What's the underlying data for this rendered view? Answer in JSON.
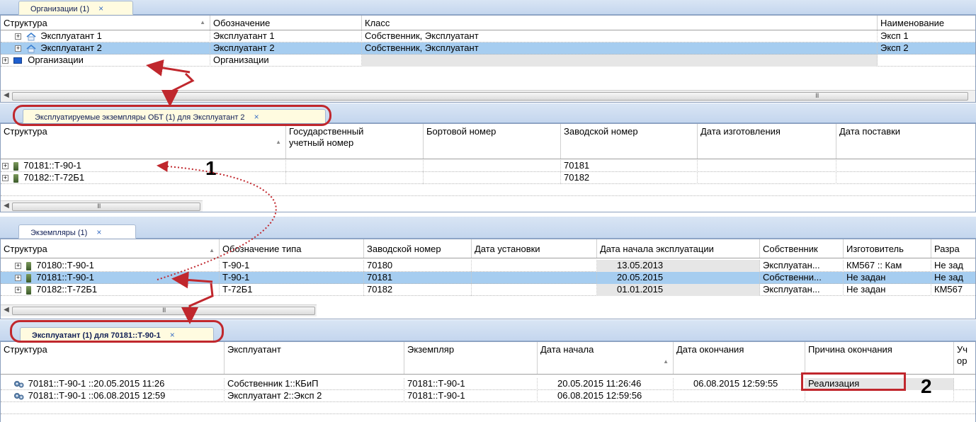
{
  "panel1": {
    "tab": "Организации (1)",
    "close": "×",
    "headers": [
      "Структура",
      "Обозначение",
      "Класс",
      "Наименование"
    ],
    "rows": [
      {
        "expander": "+",
        "name": "Эксплуатант 1",
        "designation": "Эксплуатант 1",
        "class": "Собственник, Эксплуатант",
        "title": "Эксп 1"
      },
      {
        "expander": "+",
        "name": "Эксплуатант 2",
        "designation": "Эксплуатант 2",
        "class": "Собственник, Эксплуатант",
        "title": "Эксп 2"
      },
      {
        "expander": "+",
        "name": "Организации",
        "designation": "Организации",
        "class": "",
        "title": ""
      }
    ],
    "scroll_grip": "III"
  },
  "panel2": {
    "tab": "Эксплуатируемые экземпляры ОБТ (1) для Эксплуатант 2",
    "close": "×",
    "headers": [
      "Структура",
      "Государственный",
      "учетный номер",
      "Бортовой номер",
      "Заводской номер",
      "Дата изготовления",
      "Дата поставки"
    ],
    "rows": [
      {
        "expander": "+",
        "name": "70181::Т-90-1",
        "factory": "70181"
      },
      {
        "expander": "+",
        "name": "70182::Т-72Б1",
        "factory": "70182"
      }
    ],
    "scroll_grip": "III"
  },
  "panel3": {
    "tab": "Экземпляры (1)",
    "close": "×",
    "headers": [
      "Структура",
      "Обозначение типа",
      "Заводской номер",
      "Дата установки",
      "Дата начала эксплуатации",
      "Собственник",
      "Изготовитель",
      "Разра"
    ],
    "rows": [
      {
        "expander": "+",
        "name": "70180::Т-90-1",
        "type": "Т-90-1",
        "factory": "70180",
        "install": "",
        "start": "13.05.2013",
        "owner": "Эксплуатан...",
        "maker": "КМ567 :: Кам",
        "dev": "Не зад"
      },
      {
        "expander": "+",
        "name": "70181::Т-90-1",
        "type": "Т-90-1",
        "factory": "70181",
        "install": "",
        "start": "20.05.2015",
        "owner": "Собственни...",
        "maker": "Не задан",
        "dev": "Не зад"
      },
      {
        "expander": "+",
        "name": "70182::Т-72Б1",
        "type": "Т-72Б1",
        "factory": "70182",
        "install": "",
        "start": "01.01.2015",
        "owner": "Эксплуатан...",
        "maker": "Не задан",
        "dev": "КМ567"
      }
    ],
    "scroll_grip": "III"
  },
  "panel4": {
    "tab": "Эксплуатант (1) для 70181::Т-90-1",
    "close": "×",
    "headers": [
      "Структура",
      "Эксплуатант",
      "Экземпляр",
      "Дата начала",
      "Дата окончания",
      "Причина окончания",
      "Уч",
      "ор"
    ],
    "rows": [
      {
        "name": "70181::Т-90-1 ::20.05.2015 11:26",
        "operator": "Собственник 1::КБиП",
        "instance": "70181::Т-90-1",
        "start": "20.05.2015 11:26:46",
        "end": "06.08.2015 12:59:55",
        "reason": "Реализация"
      },
      {
        "name": "70181::Т-90-1 ::06.08.2015 12:59",
        "operator": "Эксплуатант 2::Эксп 2",
        "instance": "70181::Т-90-1",
        "start": "06.08.2015 12:59:56",
        "end": "",
        "reason": ""
      }
    ]
  },
  "annotations": {
    "one": "1",
    "two": "2"
  },
  "colors": {
    "selection": "#a6cdf0",
    "accent_red": "#c0272d",
    "tab_yellow": "#fffbe0"
  }
}
